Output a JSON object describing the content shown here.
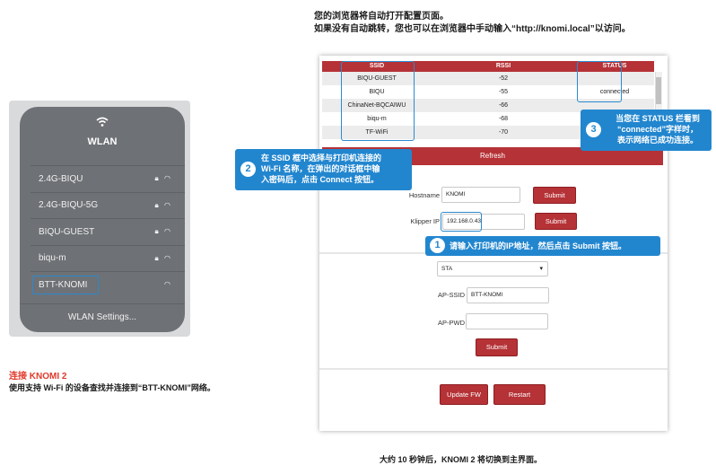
{
  "instructions": {
    "line1": "您的浏览器将自动打开配置页面。",
    "line2": "如果没有自动跳转，您也可以在浏览器中手动输入“http://knomi.local”以访问。"
  },
  "wlan": {
    "icon": "wifi-icon",
    "title": "WLAN",
    "networks": [
      {
        "name": "2.4G-BIQU"
      },
      {
        "name": "2.4G-BIQU-5G"
      },
      {
        "name": "BIQU-GUEST"
      },
      {
        "name": "biqu-m"
      },
      {
        "name": "BTT-KNOMI"
      }
    ],
    "settings_label": "WLAN Settings..."
  },
  "connect": {
    "title": "连接 KNOMI 2",
    "description": "使用支持 Wi-Fi 的设备查找并连接到“BTT-KNOMI”网络。"
  },
  "ssid_table": {
    "headers": [
      "SSID",
      "RSSI",
      "STATUS"
    ],
    "rows": [
      {
        "ssid": "BIQU-GUEST",
        "rssi": "-52",
        "status": ""
      },
      {
        "ssid": "BIQU",
        "rssi": "-55",
        "status": "connected"
      },
      {
        "ssid": "ChinaNet-BQCAIWU",
        "rssi": "-66",
        "status": ""
      },
      {
        "ssid": "biqu-m",
        "rssi": "-68",
        "status": ""
      },
      {
        "ssid": "TF-WiFi",
        "rssi": "-70",
        "status": ""
      }
    ],
    "refresh_label": "Refresh"
  },
  "form": {
    "hostname_label": "Hostname",
    "hostname_value": "KNOMI",
    "submit_label": "Submit",
    "ip_label": "Klipper IP",
    "ip_value": "192.168.0.43",
    "mode_value": "STA",
    "ap_ssid_label": "AP-SSID",
    "ap_ssid_value": "BTT-KNOMI",
    "ap_pwd_label": "AP-PWD",
    "ap_pwd_value": "",
    "update_fw_label": "Update FW",
    "restart_label": "Restart"
  },
  "callouts": {
    "c1_num": "1",
    "c1_text": "请输入打印机的IP地址，然后点击 Submit 按钮。",
    "c2_num": "2",
    "c2_line1": "在 SSID 框中选择与打印机连接的",
    "c2_line2": "Wi-Fi 名称，在弹出的对话框中输",
    "c2_line3": "入密码后，点击 Connect 按钮。",
    "c3_num": "3",
    "c3_line1": "当您在 STATUS 栏看到",
    "c3_line2": "“connected”字样时，",
    "c3_line3": "表示网络已成功连接。"
  },
  "footer_note": "大约 10 秒钟后，KNOMI 2 将切换到主界面。",
  "colors": {
    "accent_red": "#b53236",
    "callout_blue": "#2286cf",
    "title_red": "#e03a2b"
  }
}
